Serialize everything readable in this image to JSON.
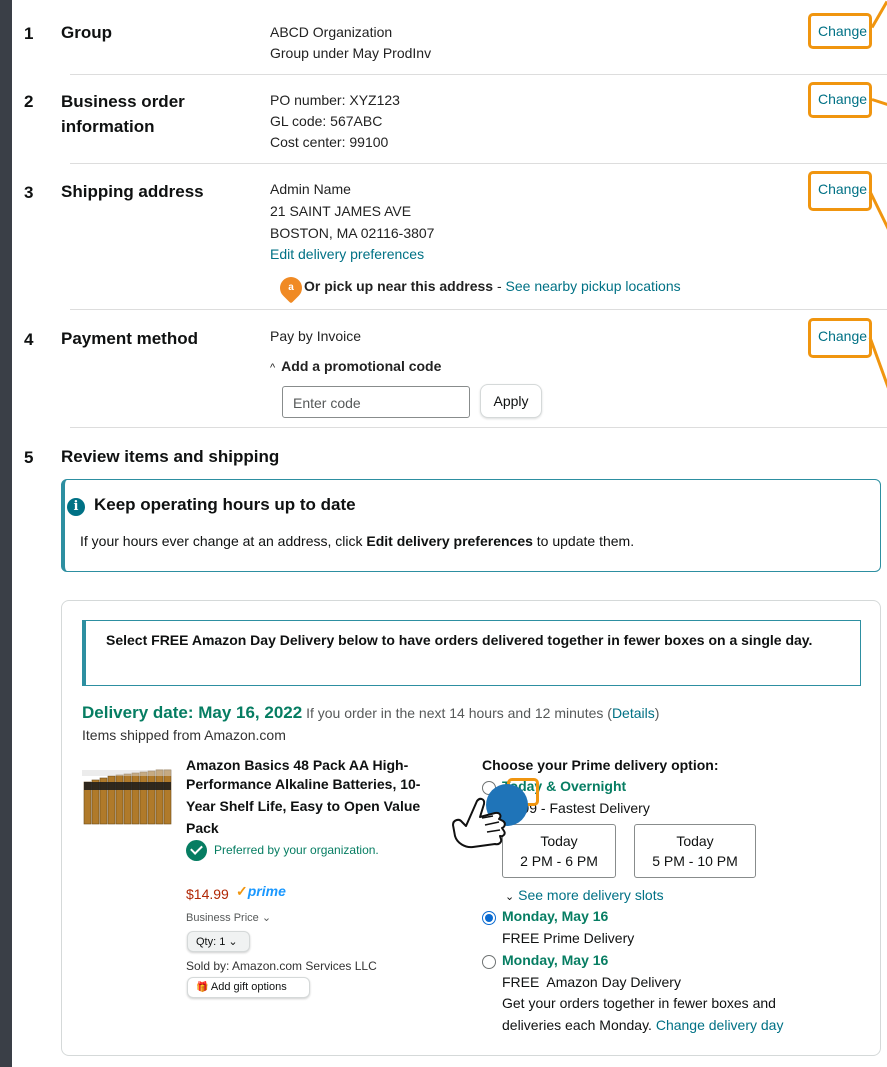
{
  "colors": {
    "accent": "#f0950f",
    "link": "#007185",
    "delivery_green": "#067d62",
    "price_red": "#b12704"
  },
  "change_label": "Change",
  "sections": [
    {
      "num": "1",
      "title_lines": [
        "Group"
      ],
      "values": [
        "ABCD Organization",
        "Group under May ProdInv"
      ]
    },
    {
      "num": "2",
      "title_lines": [
        "Business order",
        "information"
      ],
      "values": [
        "PO number: XYZ123",
        "GL code: 567ABC",
        "Cost center: 99100"
      ]
    },
    {
      "num": "3",
      "title_lines": [
        "Shipping address"
      ],
      "values": [
        "Admin Name",
        "21 SAINT JAMES AVE",
        "BOSTON, MA 02116-3807"
      ],
      "edit_link": "Edit delivery preferences",
      "pickup_bold": "Or pick up near this address",
      "pickup_sep": " - ",
      "pickup_link": "See nearby pickup locations",
      "pickup_icon": "a"
    },
    {
      "num": "4",
      "title_lines": [
        "Payment method"
      ],
      "values": [
        "Pay by Invoice"
      ],
      "promo_label": "Add a promotional code",
      "promo_caret": "^",
      "promo_placeholder": "Enter code",
      "apply_label": "Apply"
    },
    {
      "num": "5",
      "title_lines": [
        "Review items and shipping"
      ]
    }
  ],
  "alert": {
    "icon": "i",
    "title": "Keep operating hours up to date",
    "body_pre": "If your hours ever change at an address, click ",
    "body_bold": "Edit delivery preferences",
    "body_post": " to update them."
  },
  "notice": "Select FREE Amazon Day Delivery below to have orders delivered together in fewer boxes on a single day.",
  "delivery": {
    "date_label": "Delivery date: May 16, 2022",
    "condition_pre": " If you order in the next 14 hours and 12 minutes (",
    "details_link": "Details",
    "condition_post": ")",
    "shipped_from": "Items shipped from Amazon.com"
  },
  "item": {
    "title_lines": [
      "Amazon Basics 48 Pack AA High-",
      "Performance Alkaline Batteries, 10-",
      "Year Shelf Life, Easy to Open Value",
      "Pack"
    ],
    "preferred": "Preferred by your organization.",
    "price": "$14.99",
    "prime_check": "✓",
    "prime": "prime",
    "business_price": "Business Price",
    "caret": "⌄",
    "qty": "Qty: 1",
    "sold_by": "Sold by: Amazon.com Services LLC",
    "gift_icon": "🎁",
    "gift": "Add gift options"
  },
  "prime_options": {
    "heading": "Choose your Prime delivery option:",
    "option1_title": "Today & Overnight",
    "option1_price": "$2.99",
    "option1_suffix": " - Fastest Delivery",
    "slots": [
      {
        "day": "Today",
        "time": "2 PM - 6 PM"
      },
      {
        "day": "Today",
        "time": "5 PM - 10 PM"
      }
    ],
    "more_caret": "⌄",
    "more_slots": "See more delivery slots",
    "option2_title": "Monday, May 16",
    "option2_free": "FREE",
    "option2_desc": " Prime Delivery",
    "option3_title": "Monday, May 16",
    "option3_free": "FREE",
    "option3_desc": "  Amazon Day Delivery",
    "option3_line2": "Get your orders together in fewer boxes and",
    "option3_line3_pre": "deliveries each Monday. ",
    "option3_link": "Change delivery day"
  }
}
